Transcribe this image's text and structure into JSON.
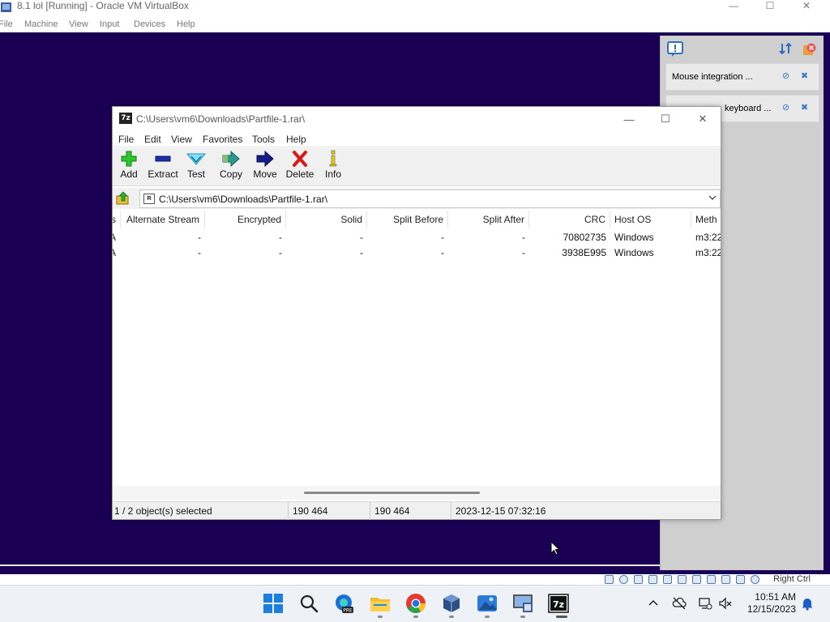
{
  "host_window": {
    "title": "8.1 lol [Running] - Oracle VM VirtualBox",
    "menu": [
      "File",
      "Machine",
      "View",
      "Input",
      "Devices",
      "Help"
    ],
    "status_right": "Right Ctrl"
  },
  "notifications": [
    {
      "text": "Mouse integration ..."
    },
    {
      "text": "keyboard ..."
    }
  ],
  "sevenzip": {
    "title": "C:\\Users\\vm6\\Downloads\\Partfile-1.rar\\",
    "menu": [
      "File",
      "Edit",
      "View",
      "Favorites",
      "Tools",
      "Help"
    ],
    "toolbar": [
      "Add",
      "Extract",
      "Test",
      "Copy",
      "Move",
      "Delete",
      "Info"
    ],
    "address": "C:\\Users\\vm6\\Downloads\\Partfile-1.rar\\",
    "columns": [
      "s",
      "Alternate Stream",
      "Encrypted",
      "Solid",
      "Split Before",
      "Split After",
      "CRC",
      "Host OS",
      "Meth"
    ],
    "rows": [
      [
        "A",
        "-",
        "-",
        "-",
        "-",
        "-",
        "70802735",
        "Windows",
        "m3:22"
      ],
      [
        "A",
        "-",
        "-",
        "-",
        "-",
        "-",
        "3938E995",
        "Windows",
        "m3:22"
      ]
    ],
    "status": {
      "selected": "1 / 2 object(s) selected",
      "size": "190 464",
      "packed": "190 464",
      "modified": "2023-12-15 07:32:16"
    }
  },
  "taskbar": {
    "time": "10:51 AM",
    "date": "12/15/2023",
    "apps": [
      "start",
      "search",
      "edge-pre",
      "file-explorer",
      "chrome",
      "virtualbox",
      "photos",
      "vm-app",
      "7zip"
    ],
    "pre_badge": "PRE",
    "sevenzip_label": "7z"
  },
  "colors": {
    "vm_background": "#1a0055",
    "taskbar": "#eef1f6"
  }
}
